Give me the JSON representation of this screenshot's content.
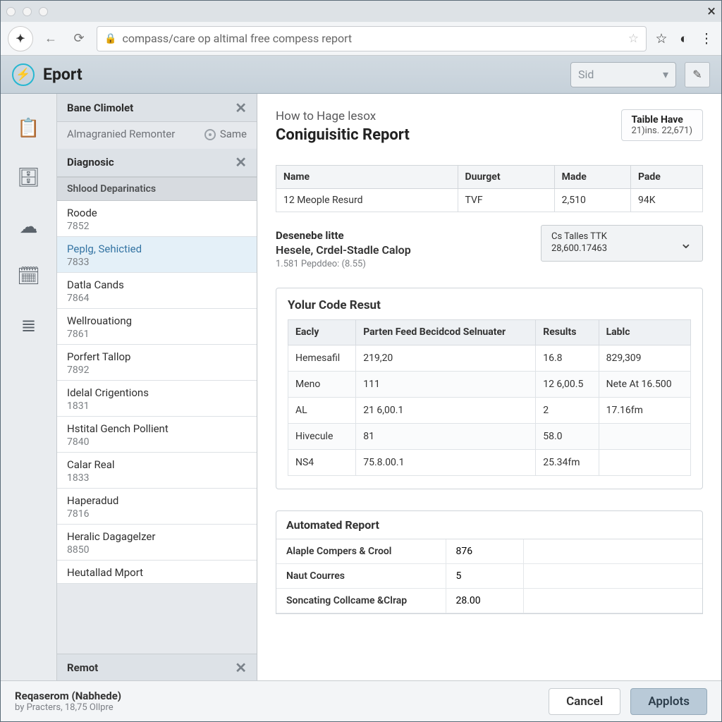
{
  "browser": {
    "url": "compass/care op altimal free compess report"
  },
  "app": {
    "title": "Eport",
    "selector_placeholder": "Sid"
  },
  "sidebar": {
    "section1_title": "Bane Climolet",
    "section1_sub": "Almagranied Remonter",
    "section1_same": "Same",
    "section2_title": "Diagnosic",
    "list_header": "Shlood Deparinatics",
    "items": [
      {
        "name": "Roode",
        "code": "7852"
      },
      {
        "name": "Peplg, Sehictied",
        "code": "7833"
      },
      {
        "name": "Datla Cands",
        "code": "7864"
      },
      {
        "name": "Wellrouationg",
        "code": "7861"
      },
      {
        "name": "Porfert Tallop",
        "code": "7892"
      },
      {
        "name": "Idelal Crigentions",
        "code": "1831"
      },
      {
        "name": "Hstital Gench Pollient",
        "code": "7840"
      },
      {
        "name": "Calar Real",
        "code": "1833"
      },
      {
        "name": "Haperadud",
        "code": "7816"
      },
      {
        "name": "Heralic Dagagelzer",
        "code": "8850"
      },
      {
        "name": "Heutallad Mport",
        "code": ""
      }
    ],
    "selected_index": 1,
    "section3_title": "Remot"
  },
  "content": {
    "overline": "How to Hage lesox",
    "title": "Coniguisitic Report",
    "table_have": {
      "label": "Taible Have",
      "value": "21)ins. 22,671)"
    },
    "summary": {
      "headers": [
        "Name",
        "Duurget",
        "Made",
        "Pade"
      ],
      "row": [
        "12 Meople Resurd",
        "TVF",
        "2,510",
        "94K"
      ]
    },
    "describe": {
      "t1": "Desenebe litte",
      "t2": "Hesele, Crdel-Stadle Calop",
      "t3": "1.581 Pepddeo: (8.55)"
    },
    "cs_dd": {
      "l1": "Cs Talles TTK",
      "l2": "28,600.17463"
    },
    "code_result": {
      "title": "Yolur Code Resut",
      "headers": [
        "Eacly",
        "Parten Feed Becidcod Selnuater",
        "Results",
        "Lablc"
      ],
      "rows": [
        [
          "Hemesafil",
          "219,20",
          "16.8",
          "829,309"
        ],
        [
          "Meno",
          "111",
          "12 6,00.5",
          "Nete At 16.500"
        ],
        [
          "AL",
          "21 6,00.1",
          "2",
          "17.16fm"
        ],
        [
          "Hivecule",
          "81",
          "58.0",
          ""
        ],
        [
          "NS4",
          "75.8.00.1",
          "25.34fm",
          ""
        ]
      ]
    },
    "automated": {
      "title": "Automated Report",
      "rows": [
        [
          "Alaple Compers & Crool",
          "876",
          ""
        ],
        [
          "Naut Courres",
          "5",
          ""
        ],
        [
          "Soncating Collcame &Clrap",
          "28.00",
          ""
        ]
      ]
    }
  },
  "footer": {
    "line1": "Reqaserom (Nabhede)",
    "line2": "by Practers, 18,75 Ollpre",
    "cancel": "Cancel",
    "apply": "Applots"
  }
}
